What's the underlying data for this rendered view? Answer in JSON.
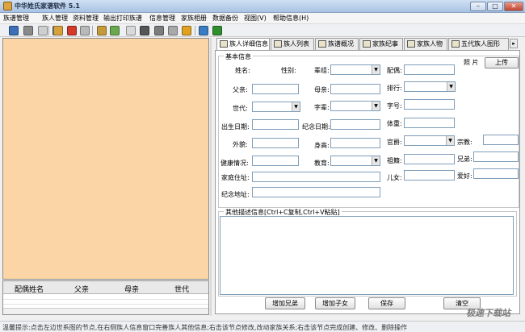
{
  "window": {
    "title": "中华姓氏家谱软件 5.1",
    "controls": {
      "minimize": "–",
      "maximize": "□",
      "close": "✕"
    }
  },
  "menu": [
    "族谱管理",
    "族人管理",
    "资料管理",
    "输出打印族谱",
    "信息管理",
    "家族相册",
    "数据备份",
    "视图(V)",
    "帮助信息(H)"
  ],
  "toolbar": {
    "icons": [
      "home-icon",
      "book-icon",
      "document-icon",
      "image-icon",
      "person-add-icon",
      "delete-icon",
      "table-icon",
      "tree-icon",
      "tree-icon",
      "file-icon",
      "binoculars-icon",
      "print-icon",
      "gear-icon",
      "chart-icon",
      "info-icon",
      "export-icon",
      "exit-icon"
    ],
    "icon_colors": [
      "#3b6fb6",
      "#8a8a8a",
      "#cfcfcf",
      "#4a7fbf",
      "#d7a13a",
      "#d23a2a",
      "#b9b9b9",
      "#c49a3b",
      "#6aa84f",
      "#d9d9d9",
      "#555555",
      "#7c7c7c",
      "#a8a8a8",
      "#e0a020",
      "#3a7cc2",
      "#5bb55b",
      "#2f8f2f"
    ]
  },
  "spouse_grid": {
    "headers": [
      "配偶姓名",
      "父亲",
      "母亲",
      "世代"
    ]
  },
  "tabs": [
    {
      "label": "族人详细信息",
      "active": true
    },
    {
      "label": "族人列表",
      "active": false
    },
    {
      "label": "族谱概况",
      "active": false
    },
    {
      "label": "家族纪事",
      "active": false
    },
    {
      "label": "家族人物",
      "active": false
    },
    {
      "label": "五代族人图形",
      "active": false
    }
  ],
  "basic_info": {
    "title": "基本信息",
    "photo_label": "照 片",
    "upload_label": "上传",
    "labels": {
      "name": "姓名:",
      "gender": "性别:",
      "cohort": "辈组:",
      "spouse": "配偶:",
      "father": "父亲:",
      "mother": "母亲:",
      "rank": "排行:",
      "generation": "世代:",
      "style_char": "字辈:",
      "courtesy": "字号:",
      "birth_date": "出生日期:",
      "memorial_date": "纪念日期:",
      "weight": "体重:",
      "appearance": "外貌:",
      "height": "身高:",
      "official_rank": "官爵:",
      "religion": "宗教:",
      "health": "健康情况:",
      "education": "教育:",
      "ancestral_home": "祖籍:",
      "siblings": "兄弟:",
      "address": "家庭住址:",
      "children": "儿女:",
      "hobby": "爱好:",
      "memorial_address": "纪念地址:"
    },
    "values": {
      "name": "",
      "cohort": "",
      "spouse": "",
      "father": "",
      "mother": "",
      "rank": "",
      "generation": "",
      "style_char": "",
      "courtesy": "",
      "birth_date": "",
      "memorial_date": "",
      "weight": "",
      "appearance": "",
      "height": "",
      "official_rank": "",
      "religion": "",
      "health": "",
      "education": "",
      "ancestral_home": "",
      "siblings": "",
      "address": "",
      "children": "",
      "hobby": "",
      "memorial_address": ""
    }
  },
  "other_info": {
    "title": "其他描述信息[Ctrl+C复制,Ctrl+V粘贴]",
    "text": ""
  },
  "buttons": {
    "add_sibling": "增加兄弟",
    "add_child": "增加子女",
    "save": "保存",
    "clear": "清空"
  },
  "status": "温馨提示:点击左边世系图的节点,在右侧族人信息窗口完善族人其他信息;右击该节点修改,改动家族关系;右击该节点完成创建、修改、删除操作",
  "watermark": "极速下载站",
  "colors": {
    "tree_panel": "#fbd5a5",
    "titlebar": "#a9c3e3",
    "field_border": "#7f9db9"
  }
}
